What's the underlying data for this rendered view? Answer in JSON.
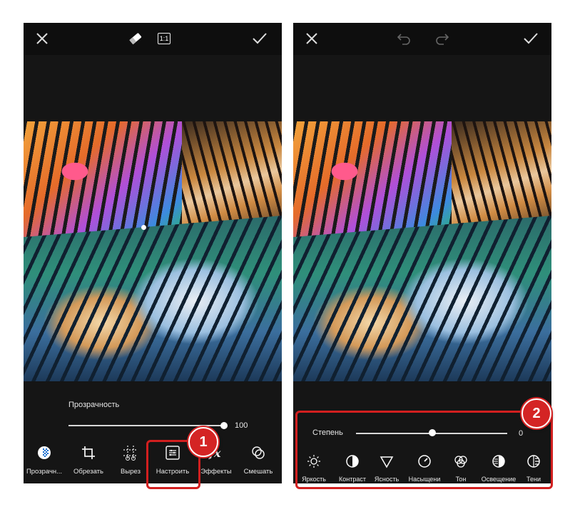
{
  "left_screen": {
    "topbar": {
      "ratio_label": "1:1"
    },
    "opacity": {
      "label": "Прозрачность",
      "value": "100"
    },
    "tools": [
      {
        "label": "Прозрачн...",
        "icon": "transparency-icon"
      },
      {
        "label": "Обрезать",
        "icon": "crop-icon"
      },
      {
        "label": "Вырез",
        "icon": "cutout-icon"
      },
      {
        "label": "Настроить",
        "icon": "adjust-icon"
      },
      {
        "label": "Эффекты",
        "icon": "effects-icon"
      },
      {
        "label": "Смешать",
        "icon": "blend-icon"
      }
    ],
    "callout_number": "1"
  },
  "right_screen": {
    "degree": {
      "label": "Степень",
      "value": "0"
    },
    "tools": [
      {
        "label": "Яркость",
        "icon": "brightness-icon"
      },
      {
        "label": "Контраст",
        "icon": "contrast-icon"
      },
      {
        "label": "Ясность",
        "icon": "clarity-icon"
      },
      {
        "label": "Насыщени",
        "icon": "saturation-icon"
      },
      {
        "label": "Тон",
        "icon": "tone-icon"
      },
      {
        "label": "Освещение",
        "icon": "highlights-icon"
      },
      {
        "label": "Тени",
        "icon": "shadows-icon"
      }
    ],
    "callout_number": "2"
  },
  "colors": {
    "accent": "#1a6fd0",
    "callout": "#d21f1f",
    "background": "#151515"
  }
}
